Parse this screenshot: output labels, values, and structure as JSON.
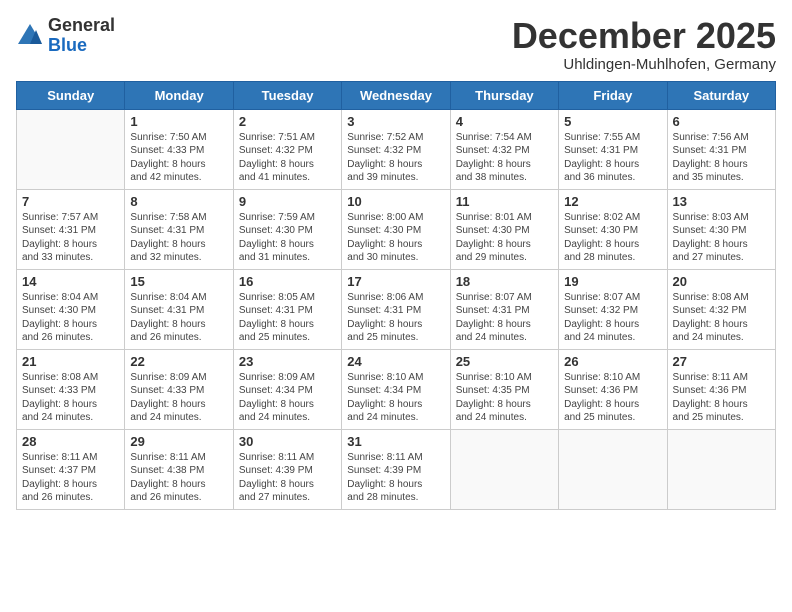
{
  "header": {
    "logo_general": "General",
    "logo_blue": "Blue",
    "month_title": "December 2025",
    "subtitle": "Uhldingen-Muhlhofen, Germany"
  },
  "weekdays": [
    "Sunday",
    "Monday",
    "Tuesday",
    "Wednesday",
    "Thursday",
    "Friday",
    "Saturday"
  ],
  "weeks": [
    [
      {
        "day": "",
        "info": ""
      },
      {
        "day": "1",
        "info": "Sunrise: 7:50 AM\nSunset: 4:33 PM\nDaylight: 8 hours\nand 42 minutes."
      },
      {
        "day": "2",
        "info": "Sunrise: 7:51 AM\nSunset: 4:32 PM\nDaylight: 8 hours\nand 41 minutes."
      },
      {
        "day": "3",
        "info": "Sunrise: 7:52 AM\nSunset: 4:32 PM\nDaylight: 8 hours\nand 39 minutes."
      },
      {
        "day": "4",
        "info": "Sunrise: 7:54 AM\nSunset: 4:32 PM\nDaylight: 8 hours\nand 38 minutes."
      },
      {
        "day": "5",
        "info": "Sunrise: 7:55 AM\nSunset: 4:31 PM\nDaylight: 8 hours\nand 36 minutes."
      },
      {
        "day": "6",
        "info": "Sunrise: 7:56 AM\nSunset: 4:31 PM\nDaylight: 8 hours\nand 35 minutes."
      }
    ],
    [
      {
        "day": "7",
        "info": "Sunrise: 7:57 AM\nSunset: 4:31 PM\nDaylight: 8 hours\nand 33 minutes."
      },
      {
        "day": "8",
        "info": "Sunrise: 7:58 AM\nSunset: 4:31 PM\nDaylight: 8 hours\nand 32 minutes."
      },
      {
        "day": "9",
        "info": "Sunrise: 7:59 AM\nSunset: 4:30 PM\nDaylight: 8 hours\nand 31 minutes."
      },
      {
        "day": "10",
        "info": "Sunrise: 8:00 AM\nSunset: 4:30 PM\nDaylight: 8 hours\nand 30 minutes."
      },
      {
        "day": "11",
        "info": "Sunrise: 8:01 AM\nSunset: 4:30 PM\nDaylight: 8 hours\nand 29 minutes."
      },
      {
        "day": "12",
        "info": "Sunrise: 8:02 AM\nSunset: 4:30 PM\nDaylight: 8 hours\nand 28 minutes."
      },
      {
        "day": "13",
        "info": "Sunrise: 8:03 AM\nSunset: 4:30 PM\nDaylight: 8 hours\nand 27 minutes."
      }
    ],
    [
      {
        "day": "14",
        "info": "Sunrise: 8:04 AM\nSunset: 4:30 PM\nDaylight: 8 hours\nand 26 minutes."
      },
      {
        "day": "15",
        "info": "Sunrise: 8:04 AM\nSunset: 4:31 PM\nDaylight: 8 hours\nand 26 minutes."
      },
      {
        "day": "16",
        "info": "Sunrise: 8:05 AM\nSunset: 4:31 PM\nDaylight: 8 hours\nand 25 minutes."
      },
      {
        "day": "17",
        "info": "Sunrise: 8:06 AM\nSunset: 4:31 PM\nDaylight: 8 hours\nand 25 minutes."
      },
      {
        "day": "18",
        "info": "Sunrise: 8:07 AM\nSunset: 4:31 PM\nDaylight: 8 hours\nand 24 minutes."
      },
      {
        "day": "19",
        "info": "Sunrise: 8:07 AM\nSunset: 4:32 PM\nDaylight: 8 hours\nand 24 minutes."
      },
      {
        "day": "20",
        "info": "Sunrise: 8:08 AM\nSunset: 4:32 PM\nDaylight: 8 hours\nand 24 minutes."
      }
    ],
    [
      {
        "day": "21",
        "info": "Sunrise: 8:08 AM\nSunset: 4:33 PM\nDaylight: 8 hours\nand 24 minutes."
      },
      {
        "day": "22",
        "info": "Sunrise: 8:09 AM\nSunset: 4:33 PM\nDaylight: 8 hours\nand 24 minutes."
      },
      {
        "day": "23",
        "info": "Sunrise: 8:09 AM\nSunset: 4:34 PM\nDaylight: 8 hours\nand 24 minutes."
      },
      {
        "day": "24",
        "info": "Sunrise: 8:10 AM\nSunset: 4:34 PM\nDaylight: 8 hours\nand 24 minutes."
      },
      {
        "day": "25",
        "info": "Sunrise: 8:10 AM\nSunset: 4:35 PM\nDaylight: 8 hours\nand 24 minutes."
      },
      {
        "day": "26",
        "info": "Sunrise: 8:10 AM\nSunset: 4:36 PM\nDaylight: 8 hours\nand 25 minutes."
      },
      {
        "day": "27",
        "info": "Sunrise: 8:11 AM\nSunset: 4:36 PM\nDaylight: 8 hours\nand 25 minutes."
      }
    ],
    [
      {
        "day": "28",
        "info": "Sunrise: 8:11 AM\nSunset: 4:37 PM\nDaylight: 8 hours\nand 26 minutes."
      },
      {
        "day": "29",
        "info": "Sunrise: 8:11 AM\nSunset: 4:38 PM\nDaylight: 8 hours\nand 26 minutes."
      },
      {
        "day": "30",
        "info": "Sunrise: 8:11 AM\nSunset: 4:39 PM\nDaylight: 8 hours\nand 27 minutes."
      },
      {
        "day": "31",
        "info": "Sunrise: 8:11 AM\nSunset: 4:39 PM\nDaylight: 8 hours\nand 28 minutes."
      },
      {
        "day": "",
        "info": ""
      },
      {
        "day": "",
        "info": ""
      },
      {
        "day": "",
        "info": ""
      }
    ]
  ]
}
